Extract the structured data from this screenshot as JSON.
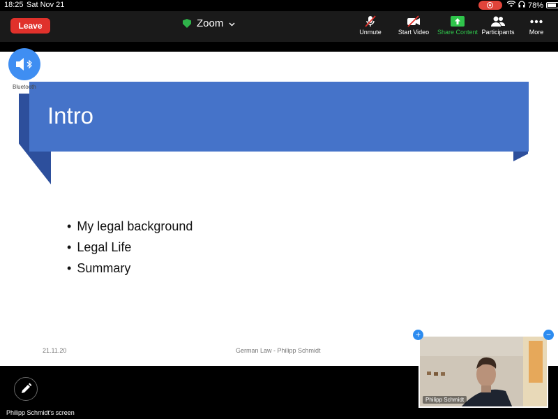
{
  "status_bar": {
    "time": "18:25",
    "date": "Sat Nov 21",
    "battery": "78%"
  },
  "toolbar": {
    "leave_label": "Leave",
    "app_title": "Zoom",
    "unmute_label": "Unmute",
    "start_video_label": "Start Video",
    "share_label": "Share Content",
    "participants_label": "Participants",
    "more_label": "More"
  },
  "bluetooth_label": "Bluetooth",
  "slide": {
    "title": "Intro",
    "bullets": [
      "My legal background",
      "Legal Life",
      "Summary"
    ],
    "footer_date": "21.11.20",
    "footer_title": "German Law - Philipp Schmidt"
  },
  "video": {
    "participant_name": "Philipp Schmidt"
  },
  "bottom": {
    "screen_label": "Philipp Schmidt's screen"
  },
  "colors": {
    "leave": "#e0312b",
    "share": "#2fc44b",
    "banner": "#4573c9",
    "accent": "#2d8cf0"
  }
}
